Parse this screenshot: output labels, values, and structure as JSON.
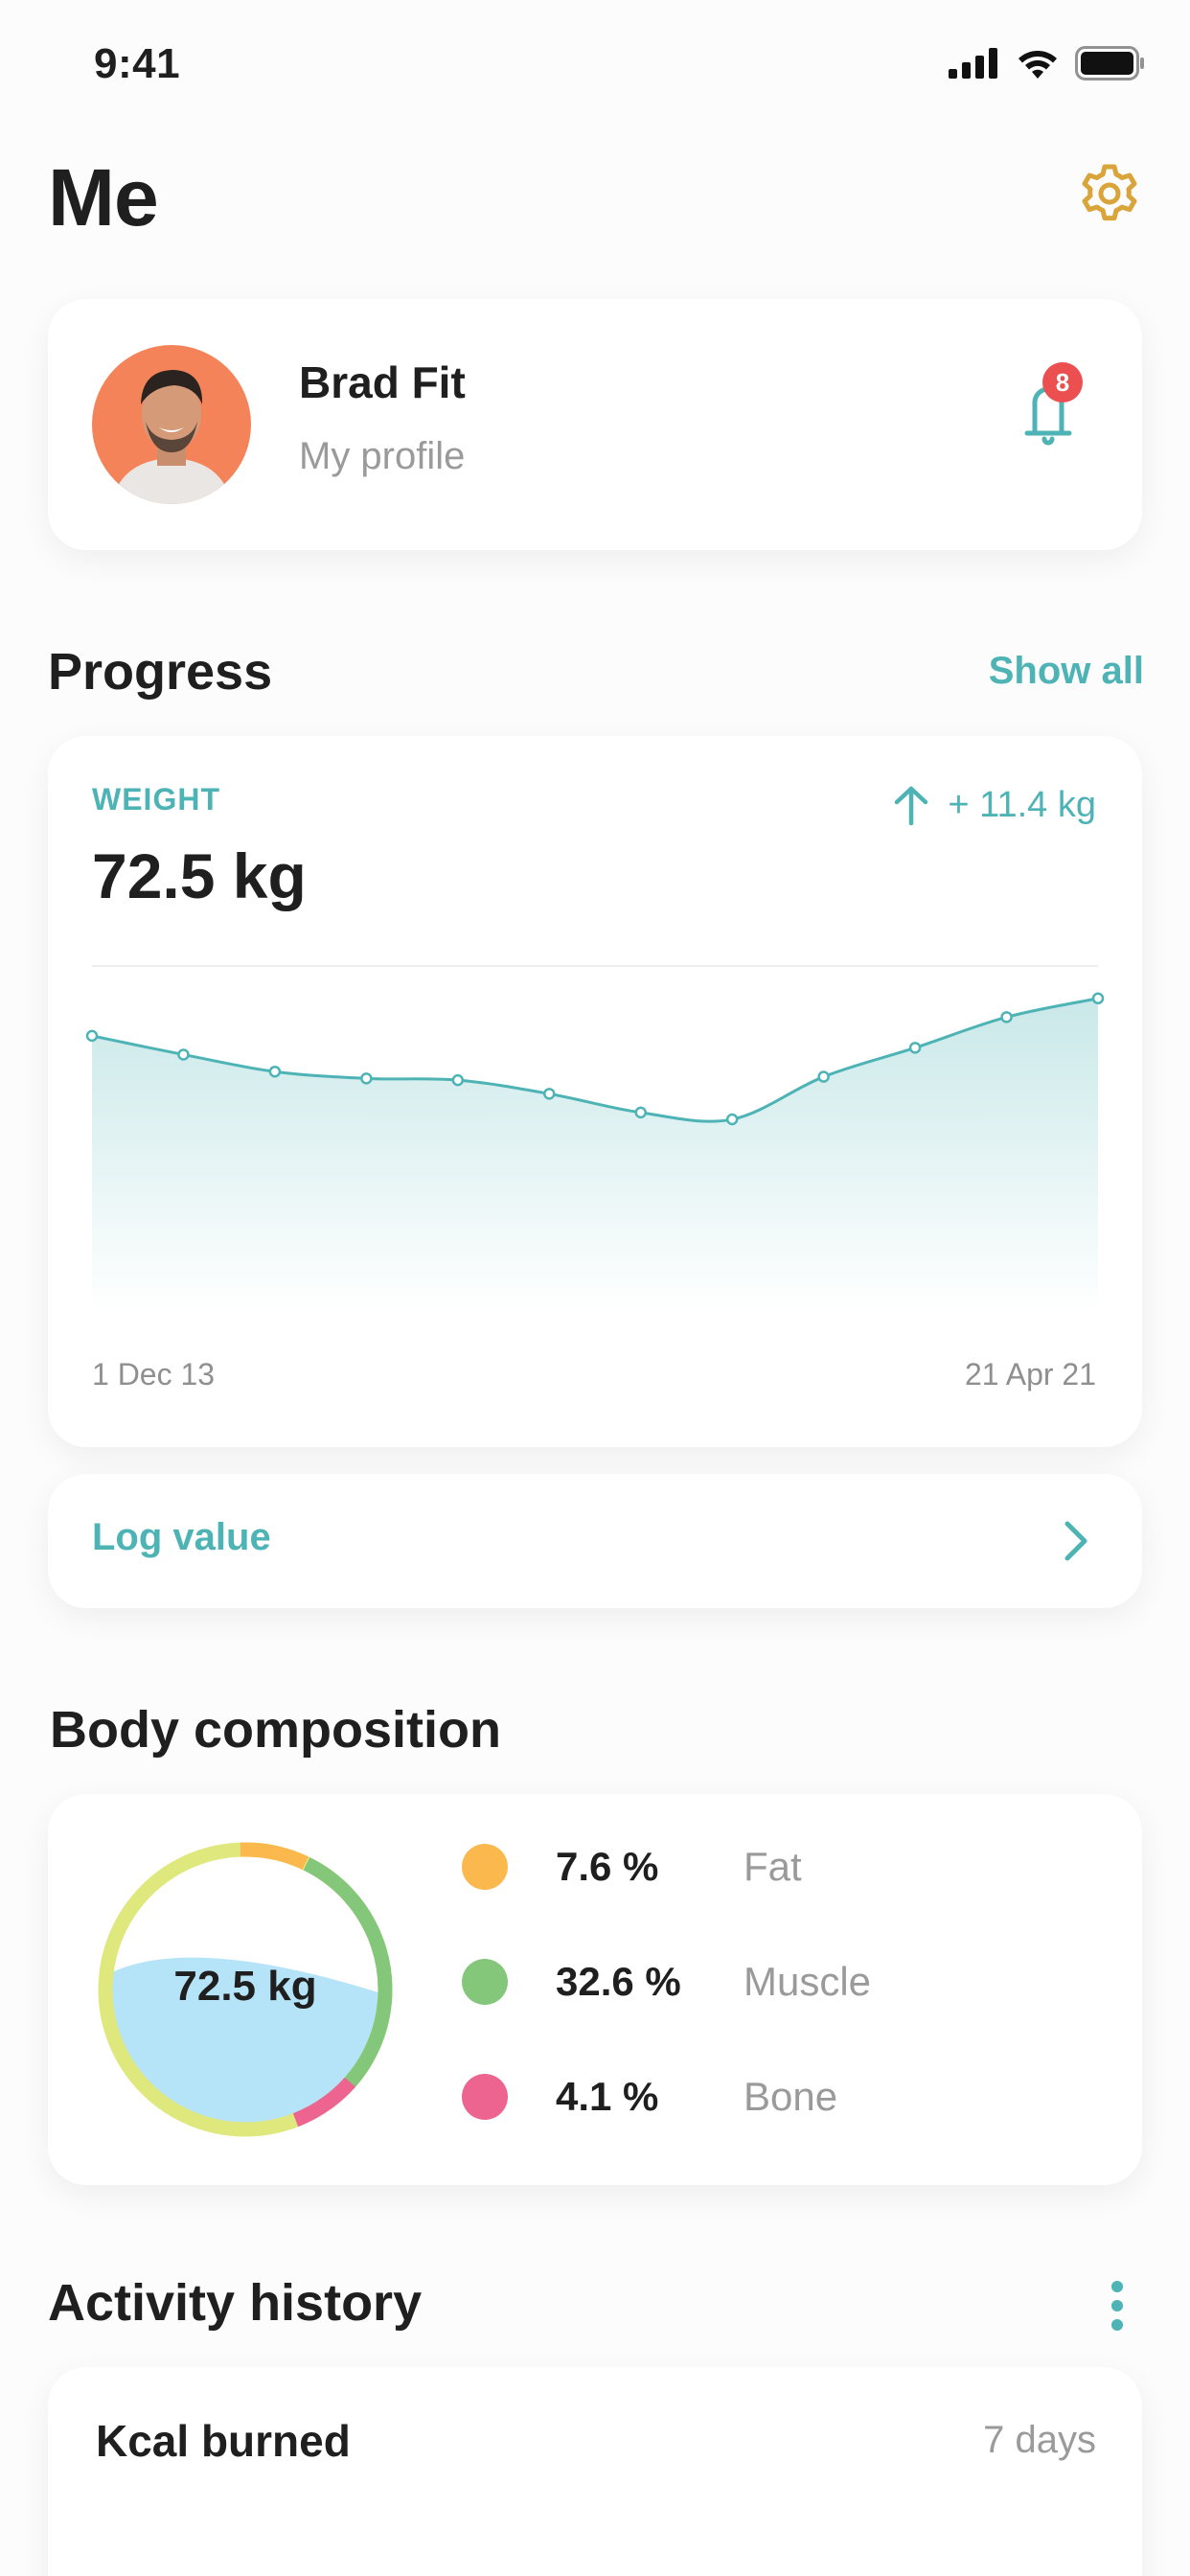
{
  "status": {
    "time": "9:41"
  },
  "header": {
    "title": "Me"
  },
  "profile": {
    "name": "Brad Fit",
    "subtitle": "My profile",
    "notifications": "8"
  },
  "progress": {
    "title": "Progress",
    "show_all": "Show all",
    "weight": {
      "label": "WEIGHT",
      "value": "72.5 kg",
      "change": "+ 11.4 kg",
      "date_start": "1 Dec 13",
      "date_end": "21 Apr 21"
    },
    "log_value": "Log value"
  },
  "chart_data": {
    "type": "area",
    "x": [
      "1 Dec 13",
      "",
      "",
      "",
      "",
      "",
      "",
      "",
      "",
      "",
      "",
      "21 Apr 21"
    ],
    "series": [
      {
        "values": [
          67.9,
          66.8,
          65.8,
          65.4,
          65.3,
          64.5,
          63.4,
          63.0,
          65.5,
          67.2,
          69.0,
          70.1
        ]
      }
    ]
  },
  "body_composition": {
    "title": "Body composition",
    "center_value": "72.5 kg",
    "items": [
      {
        "value": "7.6 %",
        "name": "Fat",
        "color": "#fbb84d"
      },
      {
        "value": "32.6 %",
        "name": "Muscle",
        "color": "#84c77b"
      },
      {
        "value": "4.1 %",
        "name": "Bone",
        "color": "#ee6491"
      }
    ],
    "colors": {
      "other": "#dfe87c",
      "water": "#b5e3f7"
    }
  },
  "activity": {
    "title": "Activity history",
    "kcal_label": "Kcal burned",
    "period": "7 days"
  },
  "colors": {
    "accent": "#4db3b5",
    "badge": "#eb4f4f",
    "settings": "#d9a53a"
  }
}
